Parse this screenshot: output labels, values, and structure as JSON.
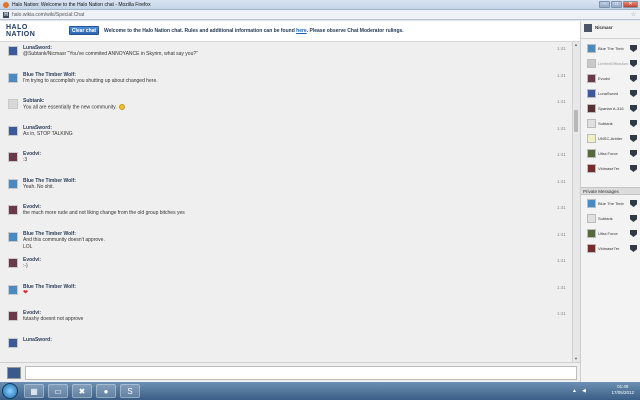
{
  "window": {
    "title": "Halo Nation: Welcome to the Halo Nation chat - Mozilla Firefox",
    "url": "halo.wikia.com/wiki/Special:Chat",
    "address_icon": "H"
  },
  "header": {
    "logo": "HALO NATION",
    "clear_chat": "Clear chat",
    "welcome_pre": "Welcome to the Halo Nation chat. Rules and additional information can be found",
    "welcome_link": "here",
    "welcome_post": ". Please observe Chat Moderator rulings."
  },
  "messages": [
    {
      "name": "LunaSword:",
      "text": "@Subtank/Nicmasr \"You've commited ANNOYANCE in Skyrim, what say you?\"",
      "time": "1:41",
      "avatar_color": "#3c5a9a"
    },
    {
      "name": "Blue The Timber Wolf:",
      "text": "I'm trying to accomplish you shutting up about changed here.",
      "time": "1:41",
      "avatar_color": "#4a8ac0"
    },
    {
      "name": "Subtank:",
      "text": "You all are essentially the new community.",
      "time": "1:41",
      "avatar_color": "#d8d8d8",
      "emoji": "smile"
    },
    {
      "name": "LunaSword:",
      "text": "As in, STOP TALKING",
      "time": "1:41",
      "avatar_color": "#3c5a9a"
    },
    {
      "name": "Evodvi:",
      "text": ":3",
      "time": "1:41",
      "avatar_color": "#6b3a4a"
    },
    {
      "name": "Blue The Timber Wolf:",
      "text": "Yeah. No shit.",
      "time": "1:41",
      "avatar_color": "#4a8ac0"
    },
    {
      "name": "Evodvi:",
      "text": "the much more rude and not liking change from the old group bitches yes",
      "time": "1:41",
      "avatar_color": "#6b3a4a"
    },
    {
      "name": "Blue The Timber Wolf:",
      "text": "And this community doesn't approve.",
      "text2": "LOL",
      "time": "1:41",
      "avatar_color": "#4a8ac0"
    },
    {
      "name": "Evodvi:",
      "text": ":-)",
      "time": "1:41",
      "avatar_color": "#6b3a4a"
    },
    {
      "name": "Blue The Timber Wolf:",
      "text": "",
      "time": "1:41",
      "avatar_color": "#4a8ac0",
      "emoji": "heart"
    },
    {
      "name": "Evodvi:",
      "text": "futashy doesnt not approve",
      "time": "1:41",
      "avatar_color": "#6b3a4a"
    },
    {
      "name": "LunaSword:",
      "text": "",
      "time": "",
      "avatar_color": "#3c5a9a"
    }
  ],
  "sidebar": {
    "me": {
      "name": "Nicmasr"
    },
    "users": [
      {
        "name": "Blue The Timb",
        "color": "#4a8ac0"
      },
      {
        "name": "LimitedOfficeAway",
        "color": "#c9c9c9",
        "away": true
      },
      {
        "name": "Evodvi",
        "color": "#6b3a4a"
      },
      {
        "name": "LunaSword",
        "color": "#3c5a9a"
      },
      {
        "name": "Spartan A-316",
        "color": "#5a3030"
      },
      {
        "name": "Subtank",
        "color": "#e0e0e0"
      },
      {
        "name": "UNSC-Arbiter",
        "color": "#f0f0c0"
      },
      {
        "name": "Ultra Force",
        "color": "#556b3a"
      },
      {
        "name": "Vidmase7er",
        "color": "#7a2a2a"
      }
    ],
    "private_heading": "Private Messages",
    "private": [
      {
        "name": "Blue The Timb",
        "color": "#4a8ac0"
      },
      {
        "name": "Subtank",
        "color": "#e0e0e0"
      },
      {
        "name": "Ultra Force",
        "color": "#556b3a"
      },
      {
        "name": "Vidmase7er",
        "color": "#7a2a2a"
      }
    ]
  },
  "taskbar": {
    "clock_time": "01:49",
    "clock_date": "17/05/2012"
  }
}
